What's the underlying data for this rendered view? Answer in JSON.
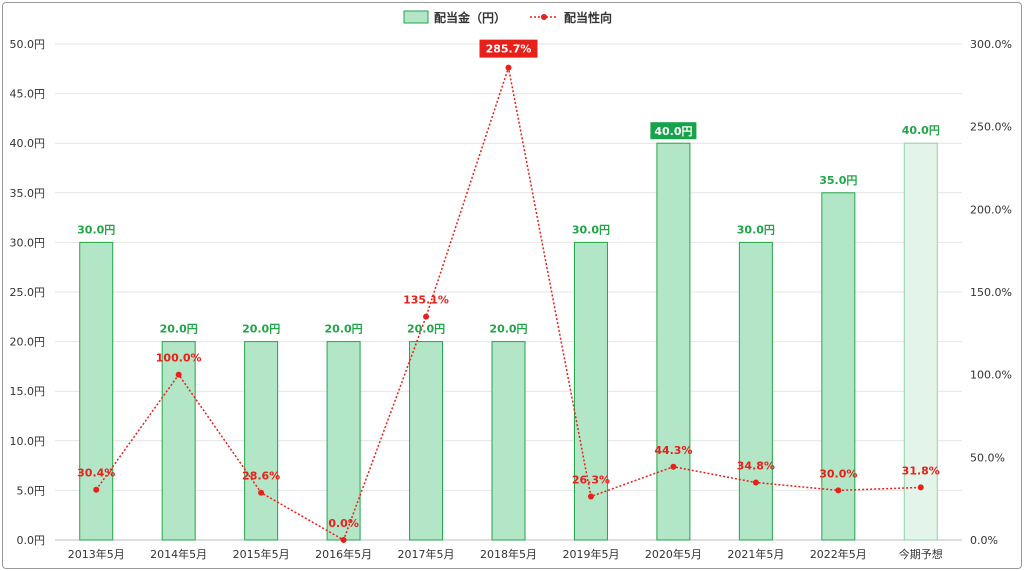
{
  "chart_data": {
    "type": "bar",
    "categories": [
      "2013年5月",
      "2014年5月",
      "2015年5月",
      "2016年5月",
      "2017年5月",
      "2018年5月",
      "2019年5月",
      "2020年5月",
      "2021年5月",
      "2022年5月",
      "今期予想"
    ],
    "series": [
      {
        "name": "配当金（円）",
        "type": "bar",
        "axis": "left",
        "values": [
          30,
          20,
          20,
          20,
          20,
          20,
          30,
          40,
          30,
          35,
          40
        ],
        "labels": [
          "30.0円",
          "20.0円",
          "20.0円",
          "20.0円",
          "20.0円",
          "20.0円",
          "30.0円",
          "40.0円",
          "30.0円",
          "35.0円",
          "40.0円"
        ],
        "highlight_index": 7,
        "forecast_index": 10,
        "color": "#b3e6c7",
        "border_color": "#22a548",
        "forecast_color": "#e3f5ea"
      },
      {
        "name": "配当性向",
        "type": "line",
        "axis": "right",
        "values": [
          30.4,
          100.0,
          28.6,
          0.0,
          135.1,
          285.7,
          26.3,
          44.3,
          34.8,
          30.0,
          31.8
        ],
        "labels": [
          "30.4%",
          "100.0%",
          "28.6%",
          "0.0%",
          "135.1%",
          "285.7%",
          "26.3%",
          "44.3%",
          "34.8%",
          "30.0%",
          "31.8%"
        ],
        "highlight_index": 5,
        "color": "#e8201a"
      }
    ],
    "y_left": {
      "min": 0,
      "max": 50,
      "step": 5,
      "tick_labels": [
        "0.0円",
        "5.0円",
        "10.0円",
        "15.0円",
        "20.0円",
        "25.0円",
        "30.0円",
        "35.0円",
        "40.0円",
        "45.0円",
        "50.0円"
      ]
    },
    "y_right": {
      "min": 0,
      "max": 300,
      "step": 50,
      "tick_labels": [
        "0.0%",
        "50.0%",
        "100.0%",
        "150.0%",
        "200.0%",
        "250.0%",
        "300.0%"
      ]
    },
    "grid": true,
    "legend_position": "top-center",
    "title": "",
    "xlabel": "",
    "ylabel": ""
  }
}
